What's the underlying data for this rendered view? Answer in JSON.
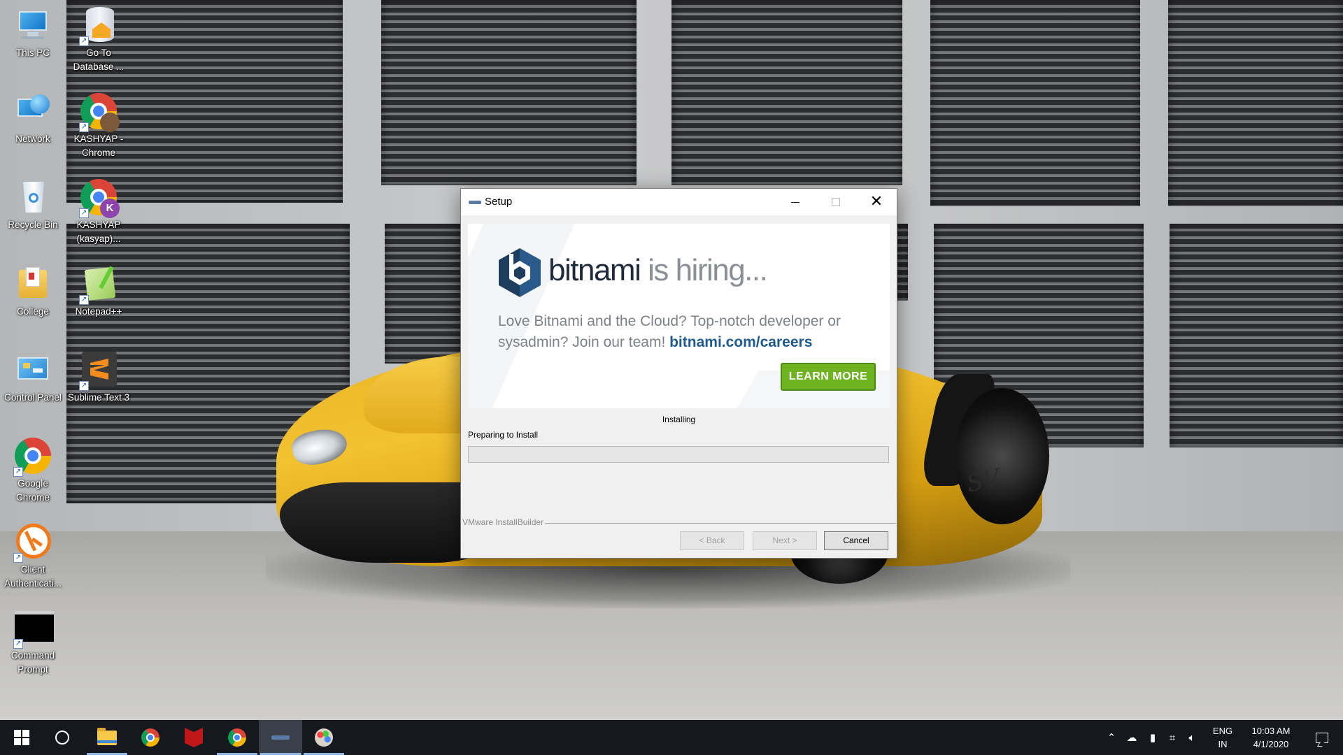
{
  "desktop": {
    "icons": [
      {
        "label": "This PC",
        "icon": "computer-icon"
      },
      {
        "label": "Go To Database ...",
        "icon": "database-home-icon"
      },
      {
        "label": "Network",
        "icon": "network-globe-icon"
      },
      {
        "label": "KASHYAP - Chrome",
        "icon": "chrome-profile-icon"
      },
      {
        "label": "Recycle Bin",
        "icon": "recycle-bin-icon"
      },
      {
        "label": "KASHYAP (kasyap)...",
        "icon": "chrome-profile-k-icon"
      },
      {
        "label": "College",
        "icon": "folder-documents-icon"
      },
      {
        "label": "Notepad++",
        "icon": "notepad-plus-plus-icon"
      },
      {
        "label": "Control Panel",
        "icon": "control-panel-icon"
      },
      {
        "label": "Sublime Text 3",
        "icon": "sublime-text-icon"
      },
      {
        "label": "Google Chrome",
        "icon": "chrome-icon"
      },
      {
        "label": "Client Authenticati...",
        "icon": "client-auth-icon"
      },
      {
        "label": "Command Prompt",
        "icon": "command-prompt-icon"
      }
    ],
    "profile_badge_letter": "K"
  },
  "dialog": {
    "title": "Setup",
    "banner": {
      "brand": "bitnami",
      "brand_suffix": " is hiring...",
      "blurb": "Love Bitnami and the Cloud? Top-notch developer or sysadmin? Join our team! ",
      "link": "bitnami.com/careers",
      "cta": "LEARN MORE",
      "accent_color": "#6fb323",
      "brand_color": "#1f5a8e"
    },
    "status_title": "Installing",
    "status_detail": "Preparing to Install",
    "progress_fraction": 0,
    "footer_label": "VMware InstallBuilder",
    "buttons": {
      "back": "< Back",
      "next": "Next >",
      "cancel": "Cancel"
    }
  },
  "taskbar": {
    "apps": [
      {
        "name": "Start",
        "icon": "windows-logo-icon"
      },
      {
        "name": "Search",
        "icon": "cortana-circle-icon"
      },
      {
        "name": "File Explorer",
        "icon": "folder-icon"
      },
      {
        "name": "Google Chrome",
        "icon": "chrome-icon"
      },
      {
        "name": "McAfee",
        "icon": "mcafee-shield-icon"
      },
      {
        "name": "Chrome (K)",
        "icon": "chrome-profile-k-icon"
      },
      {
        "name": "Setup",
        "icon": "setup-app-icon"
      },
      {
        "name": "Paint",
        "icon": "paint-palette-icon"
      }
    ],
    "tray": {
      "language_line1": "ENG",
      "language_line2": "IN",
      "time": "10:03 AM",
      "date": "4/1/2020"
    }
  }
}
